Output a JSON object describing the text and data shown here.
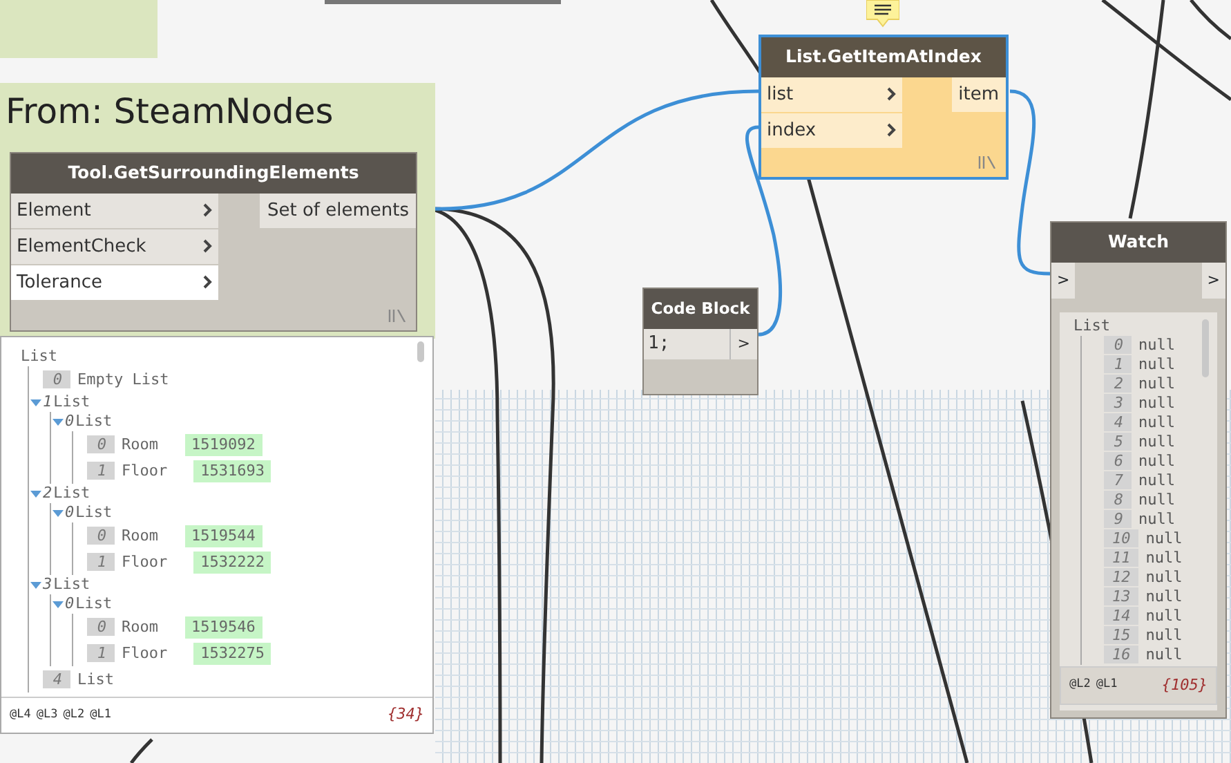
{
  "group": {
    "title": "From: SteamNodes"
  },
  "nodes": [
    {
      "kind": "function",
      "title": "Tool.GetSurroundingElements",
      "selected": false,
      "inputs": [
        {
          "label": "Element",
          "has_default": false
        },
        {
          "label": "ElementCheck",
          "has_default": false
        },
        {
          "label": "Tolerance",
          "has_default": true
        }
      ],
      "outputs": [
        "Set of elements"
      ],
      "preview": {
        "tree": {
          "label": "List",
          "children": [
            {
              "index": "0",
              "label": "Empty List"
            },
            {
              "index": "1",
              "label": "List",
              "expanded": true,
              "children": [
                {
                  "index": "0",
                  "label": "List",
                  "expanded": true,
                  "children": [
                    {
                      "index": "0",
                      "label": "Room",
                      "value": "1519092"
                    },
                    {
                      "index": "1",
                      "label": "Floor",
                      "value": "1531693"
                    }
                  ]
                }
              ]
            },
            {
              "index": "2",
              "label": "List",
              "expanded": true,
              "children": [
                {
                  "index": "0",
                  "label": "List",
                  "expanded": true,
                  "children": [
                    {
                      "index": "0",
                      "label": "Room",
                      "value": "1519544"
                    },
                    {
                      "index": "1",
                      "label": "Floor",
                      "value": "1532222"
                    }
                  ]
                }
              ]
            },
            {
              "index": "3",
              "label": "List",
              "expanded": true,
              "children": [
                {
                  "index": "0",
                  "label": "List",
                  "expanded": true,
                  "children": [
                    {
                      "index": "0",
                      "label": "Room",
                      "value": "1519546"
                    },
                    {
                      "index": "1",
                      "label": "Floor",
                      "value": "1532275"
                    }
                  ]
                }
              ]
            },
            {
              "index": "4",
              "label": "List"
            }
          ]
        },
        "levels": [
          "@L4",
          "@L3",
          "@L2",
          "@L1"
        ],
        "count": "{34}"
      }
    },
    {
      "kind": "function",
      "title": "List.GetItemAtIndex",
      "selected": true,
      "inputs": [
        {
          "label": "list",
          "has_default": false
        },
        {
          "label": "index",
          "has_default": false
        }
      ],
      "outputs": [
        "item"
      ]
    },
    {
      "kind": "code",
      "title": "Code Block",
      "selected": false,
      "code": "1;",
      "output": ">"
    },
    {
      "kind": "watch",
      "title": "Watch",
      "selected": false,
      "input": ">",
      "output": ">",
      "preview": {
        "tree": {
          "label": "List",
          "children": [
            {
              "index": "0",
              "label": "null"
            },
            {
              "index": "1",
              "label": "null"
            },
            {
              "index": "2",
              "label": "null"
            },
            {
              "index": "3",
              "label": "null"
            },
            {
              "index": "4",
              "label": "null"
            },
            {
              "index": "5",
              "label": "null"
            },
            {
              "index": "6",
              "label": "null"
            },
            {
              "index": "7",
              "label": "null"
            },
            {
              "index": "8",
              "label": "null"
            },
            {
              "index": "9",
              "label": "null"
            },
            {
              "index": "10",
              "label": "null"
            },
            {
              "index": "11",
              "label": "null"
            },
            {
              "index": "12",
              "label": "null"
            },
            {
              "index": "13",
              "label": "null"
            },
            {
              "index": "14",
              "label": "null"
            },
            {
              "index": "15",
              "label": "null"
            },
            {
              "index": "16",
              "label": "null"
            }
          ]
        },
        "levels": [
          "@L2",
          "@L1"
        ],
        "count": "{105}"
      }
    }
  ]
}
